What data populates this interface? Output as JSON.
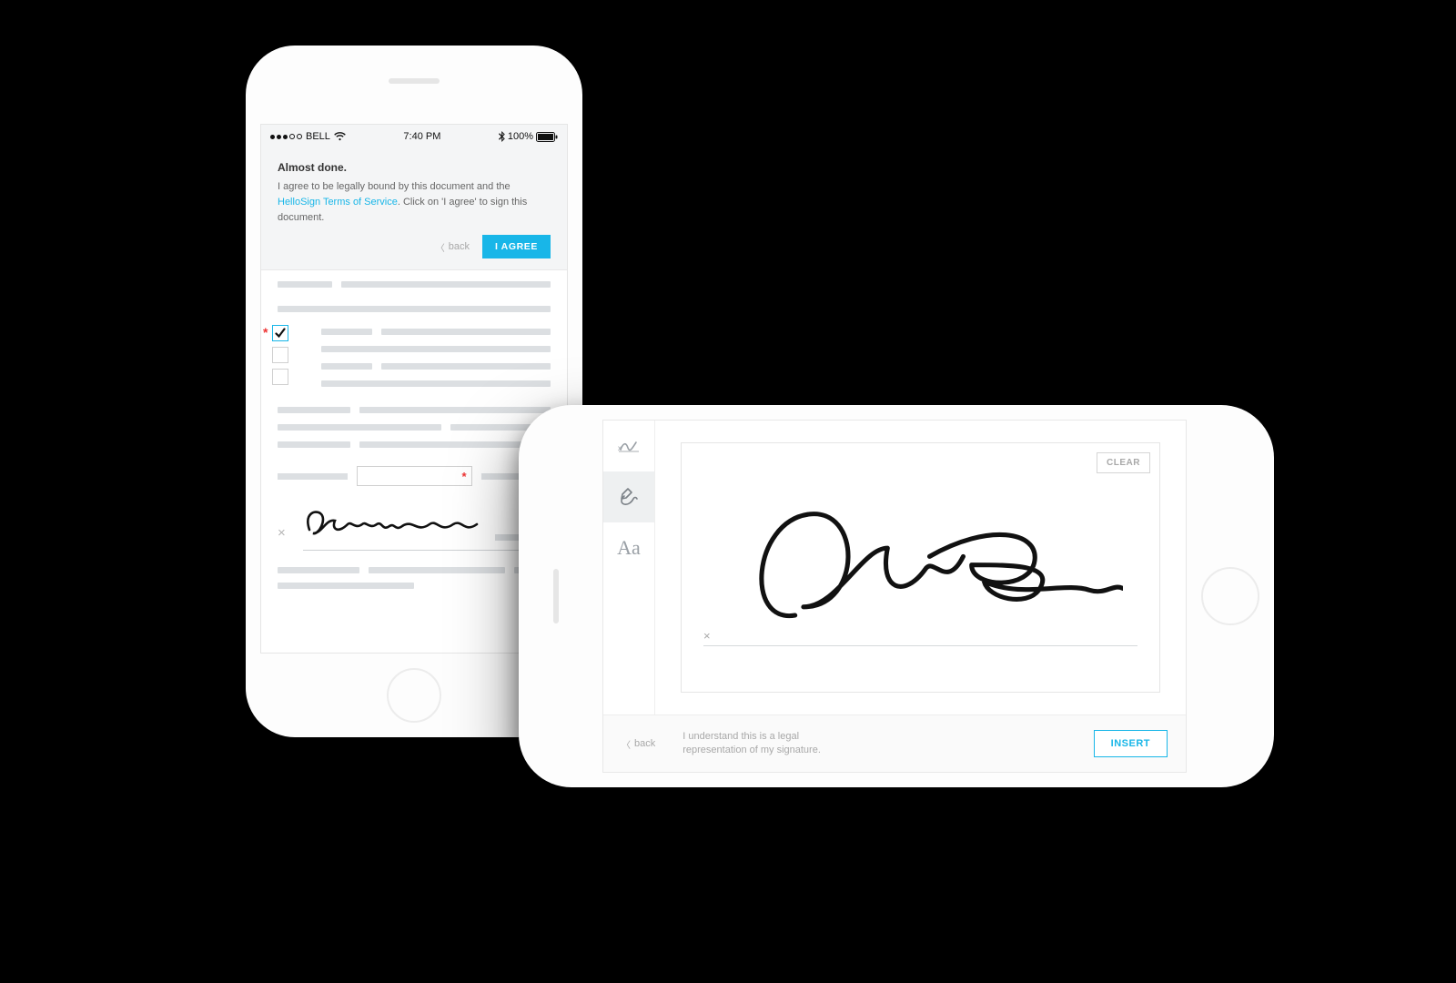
{
  "colors": {
    "accent": "#18b6e8",
    "danger": "#e33",
    "muted": "#a8a8a8"
  },
  "portrait": {
    "status": {
      "carrier": "BELL",
      "time": "7:40 PM",
      "battery": "100%"
    },
    "header": {
      "title": "Almost done.",
      "body_prefix": "I agree to be legally bound by this document and the ",
      "link_text": "HelloSign Terms of Service",
      "body_suffix": ". Click on 'I agree' to sign this document.",
      "back_label": "back",
      "agree_label": "I AGREE"
    },
    "required_mark": "*"
  },
  "landscape": {
    "tools": {
      "type_label": "Aa"
    },
    "clear_label": "CLEAR",
    "x_mark": "×",
    "footer": {
      "back_label": "back",
      "disclaimer_line1": "I understand this is a legal",
      "disclaimer_line2": "representation of my signature.",
      "insert_label": "INSERT"
    }
  }
}
